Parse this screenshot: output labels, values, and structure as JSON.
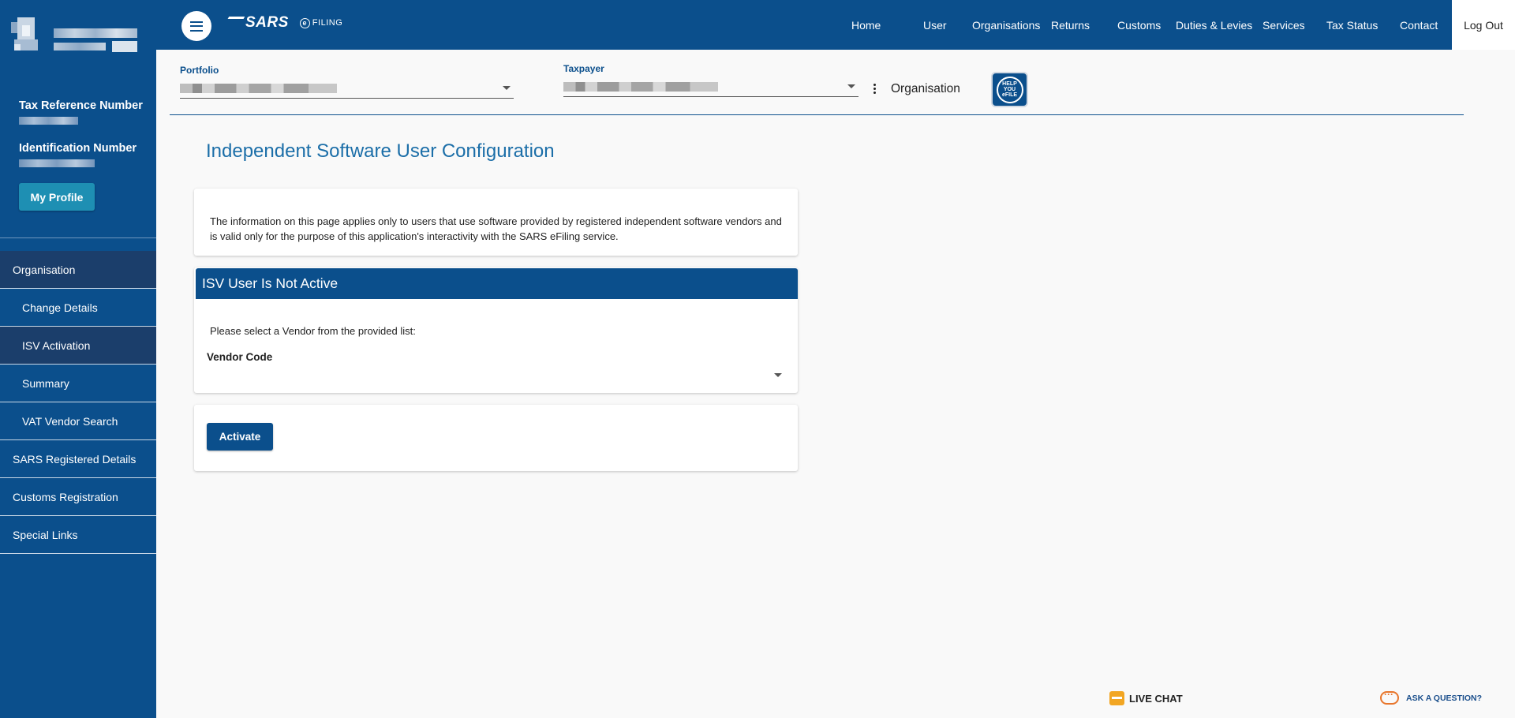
{
  "header": {
    "logo_text": "SARS",
    "efiling_text": "FILING",
    "nav": [
      {
        "label": "Home"
      },
      {
        "label": "User"
      },
      {
        "label": "Organisations"
      },
      {
        "label": "Returns"
      },
      {
        "label": "Customs"
      },
      {
        "label": "Duties & Levies"
      },
      {
        "label": "Services"
      },
      {
        "label": "Tax Status"
      },
      {
        "label": "Contact"
      }
    ],
    "logout_label": "Log Out"
  },
  "sidebar": {
    "tax_ref_label": "Tax Reference Number",
    "id_label": "Identification Number",
    "profile_button": "My Profile",
    "items": [
      {
        "label": "Organisation"
      },
      {
        "label": "Change Details"
      },
      {
        "label": "ISV Activation"
      },
      {
        "label": "Summary"
      },
      {
        "label": "VAT Vendor Search"
      },
      {
        "label": "SARS Registered Details"
      },
      {
        "label": "Customs Registration"
      },
      {
        "label": "Special Links"
      }
    ]
  },
  "selectors": {
    "portfolio_label": "Portfolio",
    "taxpayer_label": "Taxpayer",
    "context_label": "Organisation",
    "help_text": "HELP YOU eFILE"
  },
  "main": {
    "title": "Independent Software User Configuration",
    "info_text": "The information on this page applies only to users that use software provided by registered independent software vendors and is valid only for the purpose of this application's interactivity with the SARS eFiling service.",
    "status_header": "ISV User Is Not Active",
    "prompt": "Please select a Vendor from the provided list:",
    "vendor_label": "Vendor Code",
    "vendor_value": "",
    "activate_label": "Activate"
  },
  "footer": {
    "live_chat": "LIVE CHAT",
    "ask_question": "ASK A QUESTION?"
  },
  "colors": {
    "brand_blue": "#0b4f8c",
    "active_nav": "#1b3e6b",
    "profile_button": "#1e8fb3",
    "title_blue": "#1b6ea8"
  }
}
